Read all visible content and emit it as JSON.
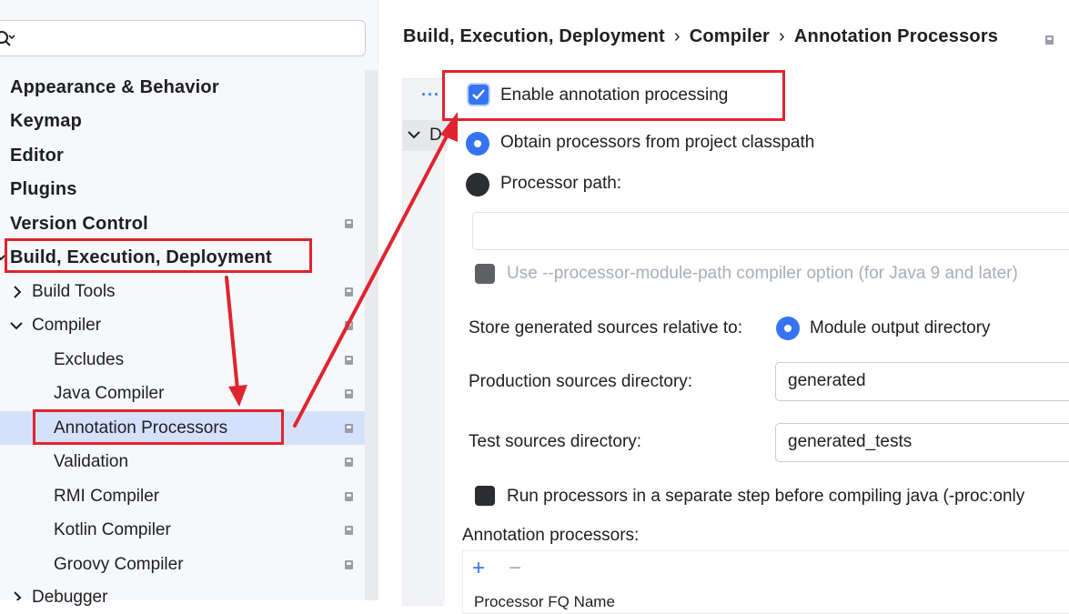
{
  "search": {
    "placeholder": "",
    "value": ""
  },
  "sidebar": {
    "items": [
      {
        "label": "Appearance & Behavior"
      },
      {
        "label": "Keymap"
      },
      {
        "label": "Editor"
      },
      {
        "label": "Plugins"
      },
      {
        "label": "Version Control"
      },
      {
        "label": "Build, Execution, Deployment"
      },
      {
        "label": "Build Tools"
      },
      {
        "label": "Compiler"
      },
      {
        "label": "Excludes"
      },
      {
        "label": "Java Compiler"
      },
      {
        "label": "Annotation Processors"
      },
      {
        "label": "Validation"
      },
      {
        "label": "RMI Compiler"
      },
      {
        "label": "Kotlin Compiler"
      },
      {
        "label": "Groovy Compiler"
      },
      {
        "label": "Debugger"
      }
    ]
  },
  "breadcrumb": {
    "items": [
      "Build, Execution, Deployment",
      "Compiler",
      "Annotation Processors"
    ],
    "separator": "›"
  },
  "profiles": {
    "dots": "···",
    "collapsed_label": "D"
  },
  "settings": {
    "enable_processing": {
      "label": "Enable annotation processing",
      "checked": true
    },
    "obtain_from_classpath": {
      "label": "Obtain processors from project classpath",
      "selected": true
    },
    "processor_path": {
      "label": "Processor path:",
      "value": ""
    },
    "module_path_option": {
      "label": "Use --processor-module-path compiler option (for Java 9 and later)",
      "enabled": false
    },
    "store_relative": {
      "label": "Store generated sources relative to:",
      "option": "Module output directory"
    },
    "production_dir": {
      "label": "Production sources directory:",
      "value": "generated"
    },
    "test_dir": {
      "label": "Test sources directory:",
      "value": "generated_tests"
    },
    "separate_step": {
      "label": "Run processors in a separate step before compiling java (-proc:only"
    },
    "annotation_processors": {
      "label": "Annotation processors:",
      "add": "+",
      "remove": "−",
      "table_header": "Processor FQ Name"
    }
  },
  "colors": {
    "accent": "#3574f0",
    "annotation": "#e0242e",
    "selection": "#d5e1fb"
  }
}
